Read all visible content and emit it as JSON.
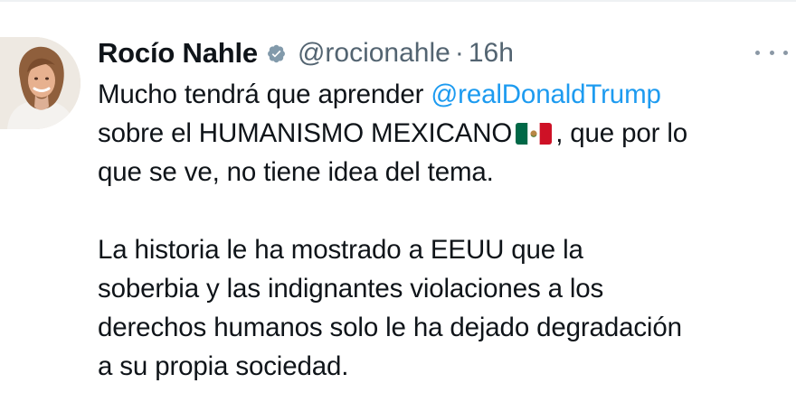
{
  "tweet": {
    "author": {
      "display_name": "Rocío Nahle",
      "verified_icon": "verified-badge-icon",
      "handle": "@rocionahle",
      "separator": "·",
      "timestamp": "16h"
    },
    "more_icon": "more-horizontal-icon",
    "body": {
      "line1_prefix": "Mucho tendrá que aprender ",
      "mention": "@realDonaldTrump",
      "line2_prefix": "sobre el HUMANISMO MEXICANO",
      "flag_icon": "mexico-flag-icon",
      "line2_suffix": ", que por lo",
      "line3": "que se ve, no tiene idea del tema.",
      "line5": "La historia le ha mostrado a EEUU  que la",
      "line6": "soberbia y las indignantes violaciones a los",
      "line7": "derechos humanos solo le ha dejado degradación",
      "line8": "a su propia sociedad."
    }
  },
  "colors": {
    "text": "#0f1419",
    "muted": "#536471",
    "link": "#1d9bf0",
    "verified": "#829aab",
    "divider": "#eef1f3"
  }
}
